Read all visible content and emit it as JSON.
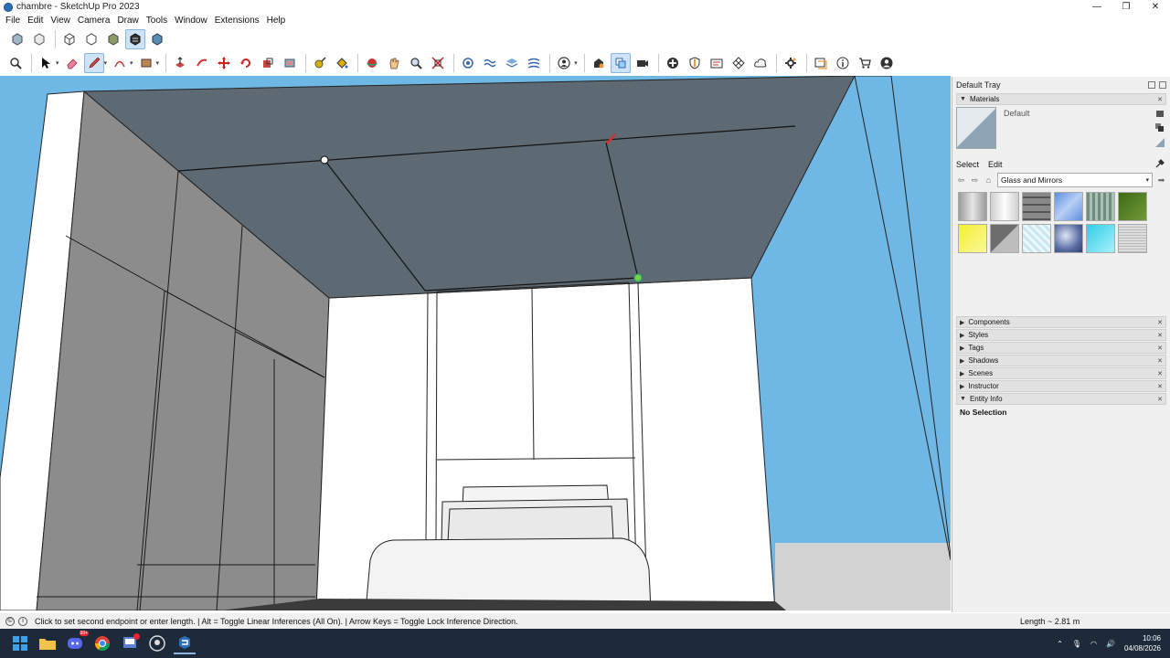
{
  "window": {
    "title": "chambre - SketchUp Pro 2023",
    "controls": [
      "—",
      "❐",
      "✕"
    ]
  },
  "menu": [
    "File",
    "Edit",
    "View",
    "Camera",
    "Draw",
    "Tools",
    "Window",
    "Extensions",
    "Help"
  ],
  "tray": {
    "title": "Default Tray",
    "materials": {
      "header": "Materials",
      "current_name": "Default",
      "tab_select": "Select",
      "tab_edit": "Edit",
      "library": "Glass and Mirrors",
      "swatches": [
        "#b9b9b9",
        "#e8e8e8",
        "#6b6b6b",
        "#7ca6ea",
        "#8ba59a",
        "#4f7a23",
        "#f3f032",
        "#8b8b8b",
        "#dff1f7",
        "#6e7fae",
        "#41d8ee",
        "#c8c8c8"
      ]
    },
    "panels": [
      "Components",
      "Styles",
      "Tags",
      "Shadows",
      "Scenes",
      "Instructor",
      "Entity Info"
    ],
    "entity_info": "No Selection"
  },
  "status": {
    "message": "Click to set second endpoint or enter length. | Alt = Toggle Linear Inferences (All On). | Arrow Keys = Toggle Lock Inference Direction.",
    "measure_label": "Length",
    "measure_value": "~ 2.81 m"
  },
  "taskbar": {
    "time": "10:06",
    "date": "04/08/2026",
    "notification_badge": "99+"
  },
  "colors": {
    "sky": "#6fb7e4",
    "ceiling": "#5e6a73",
    "wall": "#8c8c8c",
    "accent": "#8ab5e0"
  }
}
